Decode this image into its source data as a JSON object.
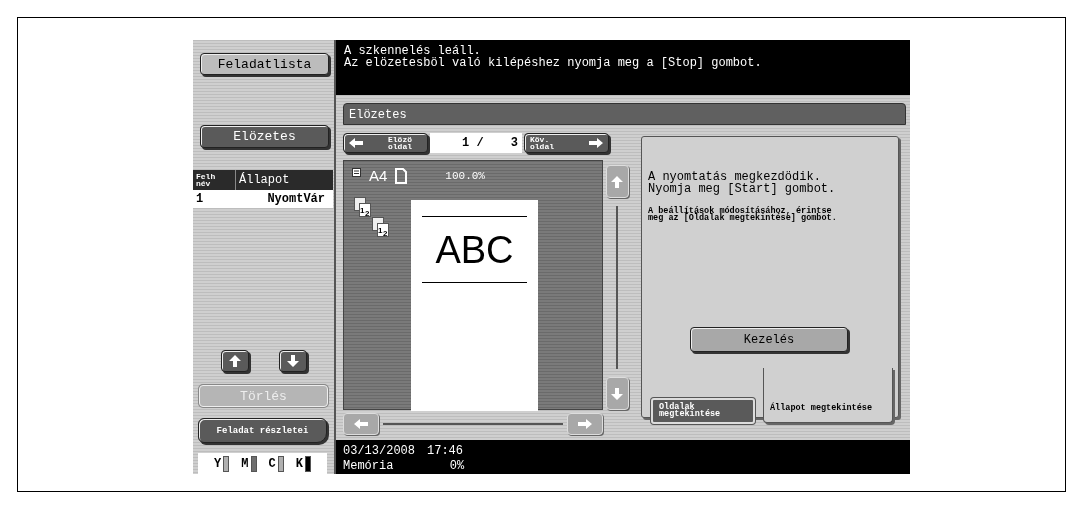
{
  "sidebar": {
    "job_list_button": {
      "label": "Feladatlista",
      "selected": false
    },
    "preview_button": {
      "label": "Elözetes",
      "selected": true
    },
    "job_table": {
      "columns": [
        "Felh név",
        "Állapot"
      ],
      "rows": [
        {
          "cells": [
            "1",
            "NyomtVár"
          ]
        }
      ]
    },
    "delete_button": {
      "label": "Törlés",
      "disabled": true
    },
    "details_button": {
      "label": "Feladat részletei"
    },
    "toner": [
      {
        "label": "Y",
        "color": "#b0b0b0"
      },
      {
        "label": "M",
        "color": "#6e6e6e"
      },
      {
        "label": "C",
        "color": "#b0b0b0"
      },
      {
        "label": "K",
        "color": "#000000"
      }
    ]
  },
  "message": [
    "A szkennelés leáll.",
    "Az elözetesböl való kilépéshez nyomja meg a [Stop] gombot."
  ],
  "preview": {
    "title": "Elözetes",
    "prev_button": "Elözö oldal",
    "page": "1 /",
    "page_count": "3",
    "next_button": "Köv. oldal",
    "paper_size": "A4",
    "zoom": "100.0%",
    "page_icons": [
      {
        "digits": [
          "1",
          "2"
        ]
      },
      {
        "digits": [
          "1",
          "2"
        ]
      }
    ],
    "page_text": "ABC"
  },
  "info": {
    "lines": [
      "A nyomtatás megkezdödik.",
      "Nyomja meg [Start] gombot."
    ],
    "hint": "A beállítások módosításához, érintse meg az [Oldalak megtekintése] gombot.",
    "button": "Kezelés",
    "tabs": [
      {
        "label": "Oldalak megtekintése",
        "selected": false
      },
      {
        "label": "Állapot megtekintése",
        "selected": true
      }
    ]
  },
  "status_bar": {
    "date": "03/13/2008",
    "time": "17:46",
    "memory_label": "Memória",
    "memory": "0%"
  }
}
